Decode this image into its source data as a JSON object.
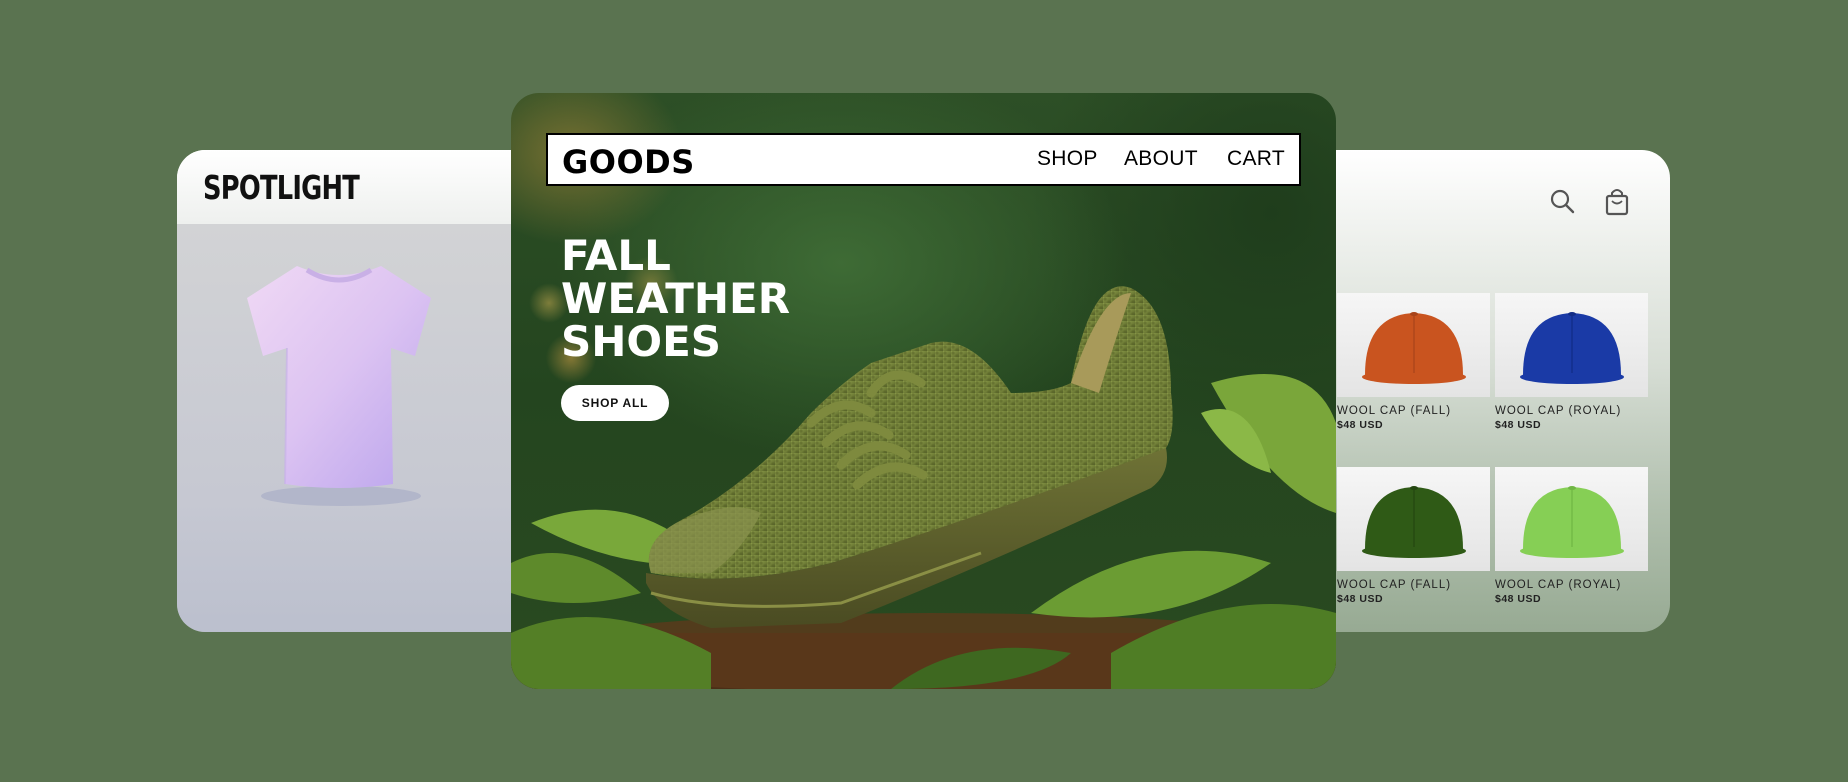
{
  "left_card": {
    "brand": "SPOTLIGHT",
    "product_image": "lavender-tshirt"
  },
  "hero": {
    "logo": "GOODS",
    "nav": [
      "SHOP",
      "ABOUT",
      "CART"
    ],
    "headline": [
      "FALL",
      "WEATHER",
      "SHOES"
    ],
    "cta_label": "SHOP ALL",
    "image": "green-knit-sneaker-on-leaves"
  },
  "right_card": {
    "icons": [
      "search-icon",
      "shopping-bag-icon"
    ],
    "products": [
      {
        "name": "WOOL CAP (FALL)",
        "price": "$48 USD",
        "color": "#c9541f"
      },
      {
        "name": "WOOL CAP (ROYAL)",
        "price": "$48 USD",
        "color": "#1a3aa6"
      },
      {
        "name": "WOOL CAP (FALL)",
        "price": "$48 USD",
        "color": "#2f5a16"
      },
      {
        "name": "WOOL CAP (ROYAL)",
        "price": "$48 USD",
        "color": "#86cf55"
      }
    ]
  },
  "colors": {
    "background": "#5a7350",
    "hero_dark_green": "#24451f",
    "nav_bg": "#ffffff"
  }
}
